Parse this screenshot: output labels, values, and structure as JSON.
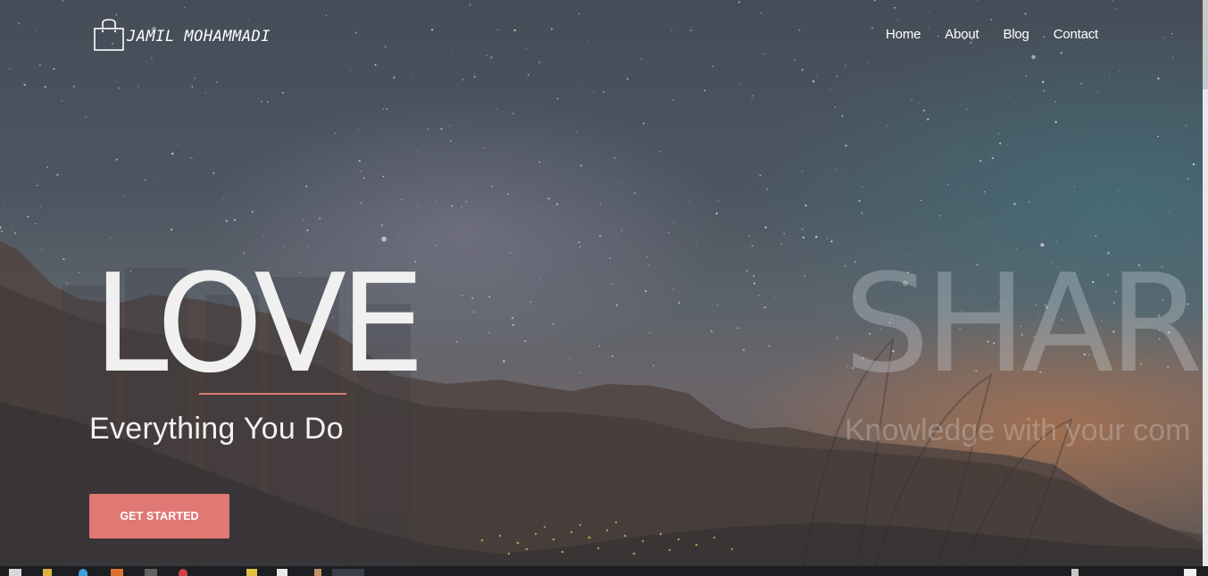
{
  "header": {
    "brand_name": "JAMIL MOHAMMADI",
    "brand_icon": "shopping-bag-icon",
    "nav": [
      "Home",
      "About",
      "Blog",
      "Contact"
    ]
  },
  "hero": {
    "slide_active": {
      "headline": "LOVE",
      "subhead": "Everything You Do",
      "cta_label": "GET STARTED"
    },
    "slide_next": {
      "headline": "SHAR",
      "subhead": "Knowledge with your com"
    }
  },
  "colors": {
    "accent": "#e07874",
    "divider": "#d97d74",
    "text": "#ffffff"
  }
}
